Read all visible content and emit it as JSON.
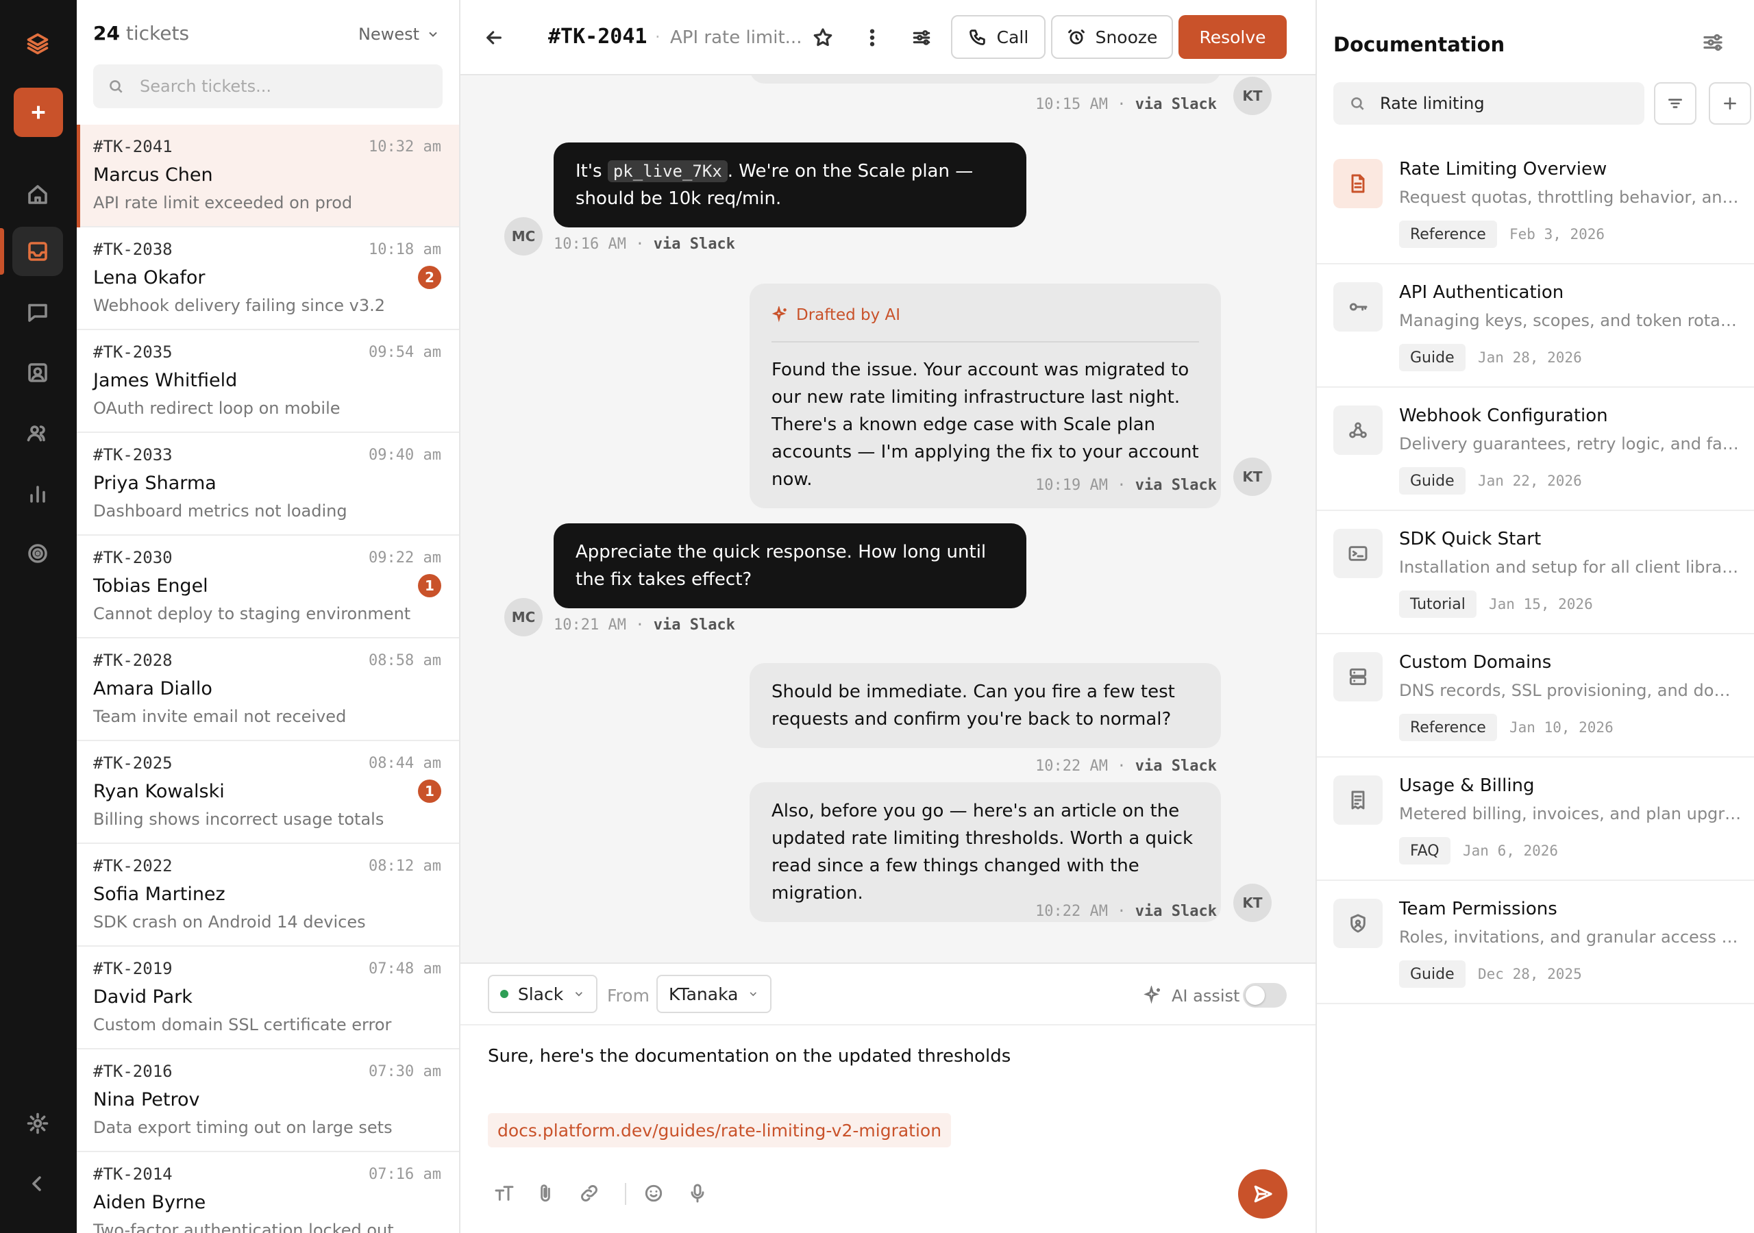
{
  "ticket_list": {
    "count": "24",
    "count_label": "tickets",
    "sort_label": "Newest",
    "search_placeholder": "Search tickets...",
    "tickets": [
      {
        "id": "#TK-2041",
        "time": "10:32 am",
        "name": "Marcus Chen",
        "subject": "API rate limit exceeded on prod",
        "selected": true
      },
      {
        "id": "#TK-2038",
        "time": "10:18 am",
        "name": "Lena Okafor",
        "subject": "Webhook delivery failing since v3.2",
        "badge": "2"
      },
      {
        "id": "#TK-2035",
        "time": "09:54 am",
        "name": "James Whitfield",
        "subject": "OAuth redirect loop on mobile"
      },
      {
        "id": "#TK-2033",
        "time": "09:40 am",
        "name": "Priya Sharma",
        "subject": "Dashboard metrics not loading"
      },
      {
        "id": "#TK-2030",
        "time": "09:22 am",
        "name": "Tobias Engel",
        "subject": "Cannot deploy to staging environment",
        "badge": "1"
      },
      {
        "id": "#TK-2028",
        "time": "08:58 am",
        "name": "Amara Diallo",
        "subject": "Team invite email not received"
      },
      {
        "id": "#TK-2025",
        "time": "08:44 am",
        "name": "Ryan Kowalski",
        "subject": "Billing shows incorrect usage totals",
        "badge": "1"
      },
      {
        "id": "#TK-2022",
        "time": "08:12 am",
        "name": "Sofia Martinez",
        "subject": "SDK crash on Android 14 devices"
      },
      {
        "id": "#TK-2019",
        "time": "07:48 am",
        "name": "David Park",
        "subject": "Custom domain SSL certificate error"
      },
      {
        "id": "#TK-2016",
        "time": "07:30 am",
        "name": "Nina Petrov",
        "subject": "Data export timing out on large sets"
      },
      {
        "id": "#TK-2014",
        "time": "07:16 am",
        "name": "Aiden Byrne",
        "subject": "Two-factor authentication locked out"
      }
    ]
  },
  "header": {
    "ticket_id": "#TK-2041",
    "separator": "·",
    "title": "API rate limit...",
    "call_label": "Call",
    "snooze_label": "Snooze",
    "resolve_label": "Resolve"
  },
  "messages": {
    "m1_meta_time": "10:15 AM",
    "m1_meta_sep": "·",
    "m1_meta_via": "via Slack",
    "m1_avatar": "KT",
    "m2_text_a": "It's ",
    "m2_code": "pk_live_7Kx",
    "m2_text_b": ". We're on the Scale plan — should be 10k req/min.",
    "m2_avatar": "MC",
    "m2_meta_time": "10:16 AM",
    "m2_meta_sep": "·",
    "m2_meta_via": "via Slack",
    "m3_ai_label": "Drafted by AI",
    "m3_text": "Found the issue. Your account was migrated to our new rate limiting infrastructure last night. There's a known edge case with Scale plan accounts — I'm applying the fix to your account now.",
    "m3_meta_time": "10:19 AM",
    "m3_meta_sep": "·",
    "m3_meta_via": "via Slack",
    "m3_avatar": "KT",
    "m4_text": "Appreciate the quick response. How long until the fix takes effect?",
    "m4_avatar": "MC",
    "m4_meta_time": "10:21 AM",
    "m4_meta_sep": "·",
    "m4_meta_via": "via Slack",
    "m5_text": "Should be immediate. Can you fire a few test requests and confirm you're back to normal?",
    "m5_meta_time": "10:22 AM",
    "m5_meta_sep": "·",
    "m5_meta_via": "via Slack",
    "m6_text": "Also, before you go — here's an article on the updated rate limiting thresholds. Worth a quick read since a few things changed with the migration.",
    "m6_meta_time": "10:22 AM",
    "m6_meta_sep": "·",
    "m6_meta_via": "via Slack",
    "m6_avatar": "KT"
  },
  "composer": {
    "channel": "Slack",
    "from_label": "From",
    "from_value": "KTanaka",
    "ai_assist_label": "AI assist",
    "ai_assist_on": false,
    "text": "Sure, here's the documentation on the updated thresholds",
    "link": "docs.platform.dev/guides/rate-limiting-v2-migration"
  },
  "docs": {
    "title": "Documentation",
    "search_value": "Rate limiting",
    "items": [
      {
        "title": "Rate Limiting Overview",
        "desc": "Request quotas, throttling behavior, and plan limits",
        "tag": "Reference",
        "date": "Feb 3, 2026",
        "icon": "document-icon"
      },
      {
        "title": "API Authentication",
        "desc": "Managing keys, scopes, and token rotation policies",
        "tag": "Guide",
        "date": "Jan 28, 2026",
        "icon": "key-icon"
      },
      {
        "title": "Webhook Configuration",
        "desc": "Delivery guarantees, retry logic, and failure handling",
        "tag": "Guide",
        "date": "Jan 22, 2026",
        "icon": "webhook-icon"
      },
      {
        "title": "SDK Quick Start",
        "desc": "Installation and setup for all client libraries",
        "tag": "Tutorial",
        "date": "Jan 15, 2026",
        "icon": "terminal-icon"
      },
      {
        "title": "Custom Domains",
        "desc": "DNS records, SSL provisioning, and domain verification",
        "tag": "Reference",
        "date": "Jan 10, 2026",
        "icon": "server-icon"
      },
      {
        "title": "Usage & Billing",
        "desc": "Metered billing, invoices, and plan upgrade options",
        "tag": "FAQ",
        "date": "Jan 6, 2026",
        "icon": "receipt-icon"
      },
      {
        "title": "Team Permissions",
        "desc": "Roles, invitations, and granular access control",
        "tag": "Guide",
        "date": "Dec 28, 2025",
        "icon": "shield-icon"
      }
    ]
  },
  "colors": {
    "accent": "#c9522a",
    "rail": "#141414",
    "incoming_bubble": "#141414",
    "outgoing_bubble": "#e9e9e9",
    "online": "#2e9e55"
  }
}
